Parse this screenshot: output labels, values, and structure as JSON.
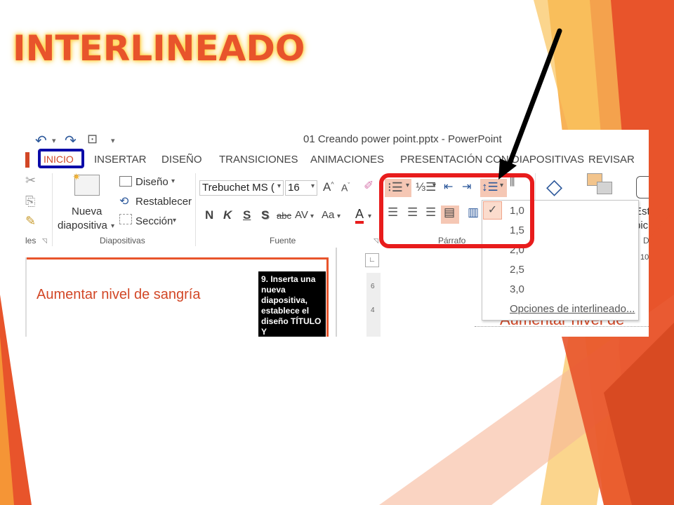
{
  "slide": {
    "title": "INTERLINEADO"
  },
  "app": {
    "window_title": "01 Creando power point.pptx - PowerPoint"
  },
  "tabs": [
    {
      "label": "INICIO",
      "active": true
    },
    {
      "label": "INSERTAR"
    },
    {
      "label": "DISEÑO"
    },
    {
      "label": "TRANSICIONES"
    },
    {
      "label": "ANIMACIONES"
    },
    {
      "label": "PRESENTACIÓN CON DIAPOSITIVAS"
    },
    {
      "label": "REVISAR"
    }
  ],
  "ribbon": {
    "diapositivas": {
      "nueva_line1": "Nueva",
      "nueva_line2": "diapositiva",
      "diseno": "Diseño",
      "restablecer": "Restablecer",
      "seccion": "Sección",
      "group_label": "Diapositivas"
    },
    "portapapeles": {
      "group_label_partial": "les"
    },
    "fuente": {
      "font_name": "Trebuchet MS (",
      "font_size": "16",
      "group_label": "Fuente",
      "bold": "N",
      "italic": "K",
      "underline": "S",
      "shadow": "S",
      "strike": "abc",
      "spacing": "AV",
      "case": "Aa",
      "grow": "A",
      "shrink": "A",
      "color_a": "A"
    },
    "parrafo": {
      "group_label": "Párrafo"
    },
    "estilos_partial": "Est",
    "estilos_partial2": "pic",
    "d_partial": "D"
  },
  "line_spacing_menu": {
    "options": [
      "1,0",
      "1,5",
      "2,0",
      "2,5",
      "3,0"
    ],
    "selected": "1,0",
    "more": "Opciones de interlineado..."
  },
  "document": {
    "slide_text": "Aumentar nivel de sangría",
    "note_text": "9. Inserta una nueva diapositiva, establece el diseño TÍTULO Y",
    "right_slide_text": "Aumentar nivel de",
    "ruler_number": "10"
  },
  "colors": {
    "accent": "#e8542b",
    "highlight_box": "#e81c1c",
    "inicio_box": "#0c0ca8",
    "arrow": "#000000"
  }
}
